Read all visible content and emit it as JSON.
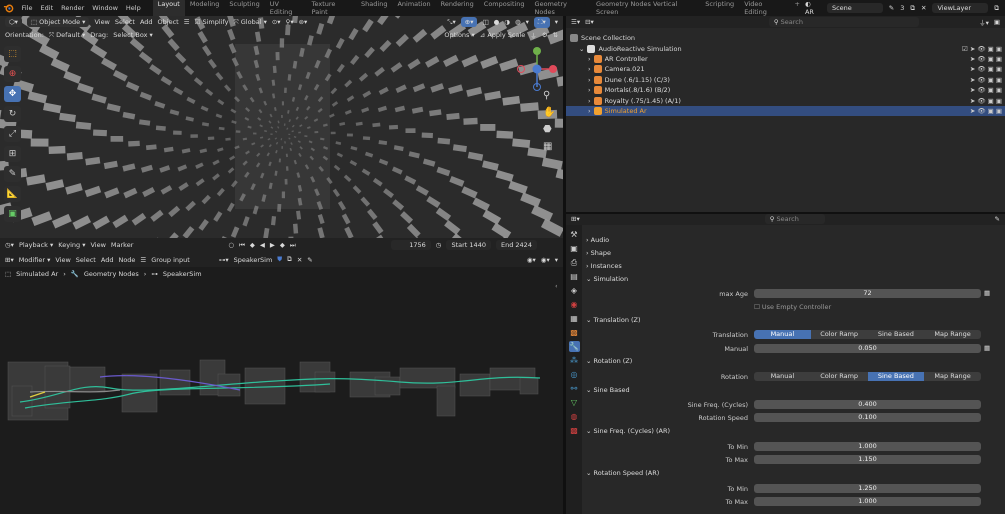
{
  "topbar": {
    "menus": [
      "File",
      "Edit",
      "Render",
      "Window",
      "Help"
    ],
    "workspaces": [
      "Layout",
      "Modeling",
      "Sculpting",
      "UV Editing",
      "Texture Paint",
      "Shading",
      "Animation",
      "Rendering",
      "Compositing",
      "Geometry Nodes",
      "Geometry Nodes Vertical Screen",
      "Scripting",
      "Video Editing"
    ],
    "active_workspace": "Layout",
    "add_tab": "+",
    "scene_short": "AR",
    "scene": "Scene",
    "scene_users": "3",
    "viewlayer": "ViewLayer"
  },
  "viewport": {
    "mode": "Object Mode",
    "menus": [
      "View",
      "Select",
      "Add",
      "Object"
    ],
    "simplify": "Simplify",
    "transform": "Global",
    "orientation_label": "Orientation:",
    "orientation_value": "Default",
    "drag_label": "Drag:",
    "drag_value": "Select Box",
    "options": "Options",
    "apply_scale": "Apply Scale"
  },
  "timeline": {
    "playback": "Playback",
    "keying": "Keying",
    "view": "View",
    "marker": "Marker",
    "current_frame": "1756",
    "start_label": "Start",
    "start": "1440",
    "end_label": "End",
    "end": "2424"
  },
  "node_editor": {
    "type": "Modifier",
    "menus": [
      "View",
      "Select",
      "Add",
      "Node"
    ],
    "group_input": "Group input",
    "tree_name": "SpeakerSim",
    "breadcrumb": [
      "Simulated Ar",
      "Geometry Nodes",
      "SpeakerSim"
    ]
  },
  "outliner": {
    "search_placeholder": "Search",
    "root": "Scene Collection",
    "items": [
      {
        "name": "AudioReactive Simulation",
        "indent": 1,
        "color": "#dddddd",
        "icon": "collection-icon"
      },
      {
        "name": "AR Controller",
        "indent": 2,
        "color": "#e8893a",
        "icon": "object-icon"
      },
      {
        "name": "Camera.021",
        "indent": 2,
        "color": "#e8893a",
        "icon": "camera-icon"
      },
      {
        "name": "Dune (.6/1.15) (C/3)",
        "indent": 2,
        "color": "#e8893a",
        "icon": "object-icon"
      },
      {
        "name": "Mortals(.8/1.6) (B/2)",
        "indent": 2,
        "color": "#e8893a",
        "icon": "object-icon"
      },
      {
        "name": "Royalty (.75/1.45) (A/1)",
        "indent": 2,
        "color": "#e8893a",
        "icon": "object-icon"
      },
      {
        "name": "Simulated Ar",
        "indent": 2,
        "color": "#f0a030",
        "icon": "mesh-icon",
        "selected": true
      }
    ]
  },
  "properties": {
    "search_placeholder": "Search",
    "sections": [
      "Audio",
      "Shape",
      "Instances",
      "Simulation"
    ],
    "max_age_label": "max Age",
    "max_age": "72",
    "use_empty_controller": "Use Empty Controller",
    "translation_panel": "Translation (Z)",
    "translation_label": "Translation",
    "modes": [
      "Manual",
      "Color Ramp",
      "Sine Based",
      "Map Range"
    ],
    "translation_active": 0,
    "manual_label": "Manual",
    "manual_value": "0.050",
    "rotation_panel": "Rotation (Z)",
    "rotation_label": "Rotation",
    "rotation_active": 2,
    "sine_panel": "Sine Based",
    "sine_freq_label": "Sine Freq. (Cycles)",
    "sine_freq": "0.400",
    "rot_speed_label": "Rotation Speed",
    "rot_speed": "0.100",
    "sine_ar_panel": "Sine Freq. (Cycles) (AR)",
    "to_min_label": "To Min",
    "to_min_1": "1.000",
    "to_max_label": "To Max",
    "to_max_1": "1.150",
    "rot_ar_panel": "Rotation Speed (AR)",
    "to_min_2": "1.250",
    "to_max_2": "1.000"
  },
  "colors": {
    "accent": "#4772b3",
    "selected_row": "#334d80",
    "object_orange": "#e8893a"
  }
}
